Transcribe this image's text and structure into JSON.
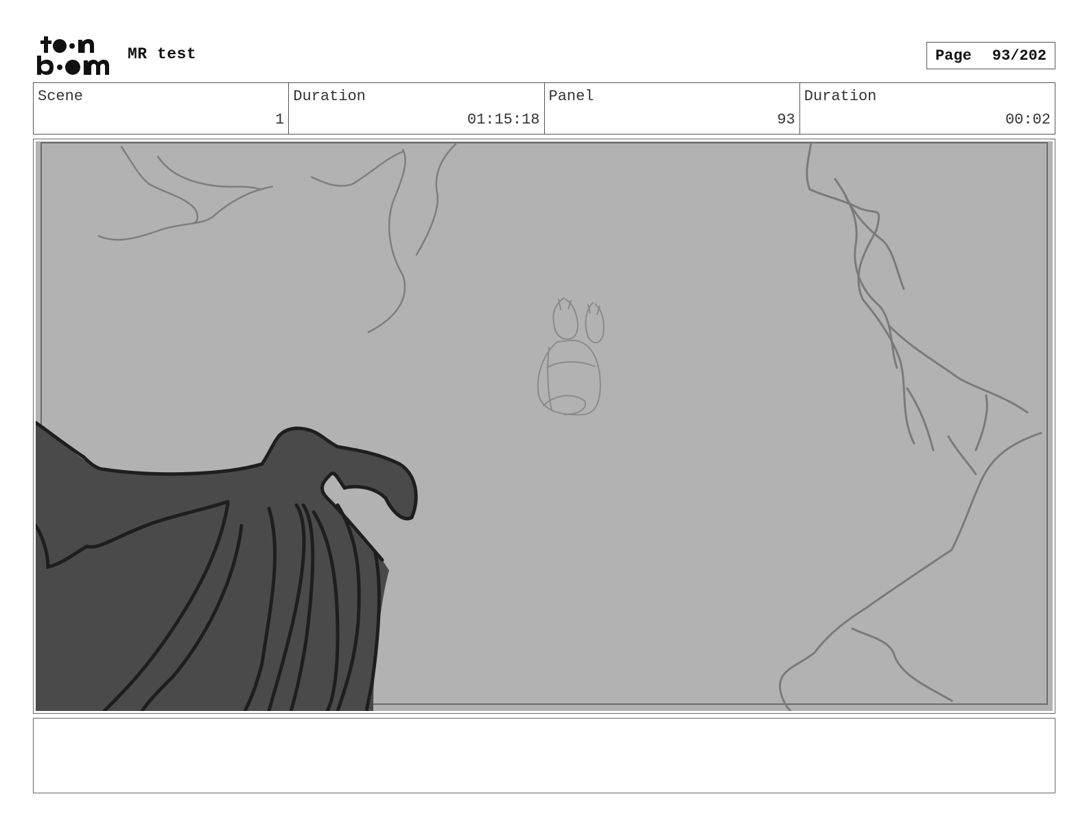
{
  "header": {
    "logo_text": "toon boom",
    "project_title": "MR test",
    "page_label": "Page",
    "page_value": "93/202"
  },
  "info": {
    "scene_label": "Scene",
    "scene_value": "1",
    "scene_duration_label": "Duration",
    "scene_duration_value": "01:15:18",
    "panel_label": "Panel",
    "panel_value": "93",
    "panel_duration_label": "Duration",
    "panel_duration_value": "00:02"
  },
  "notes": {
    "text": ""
  }
}
